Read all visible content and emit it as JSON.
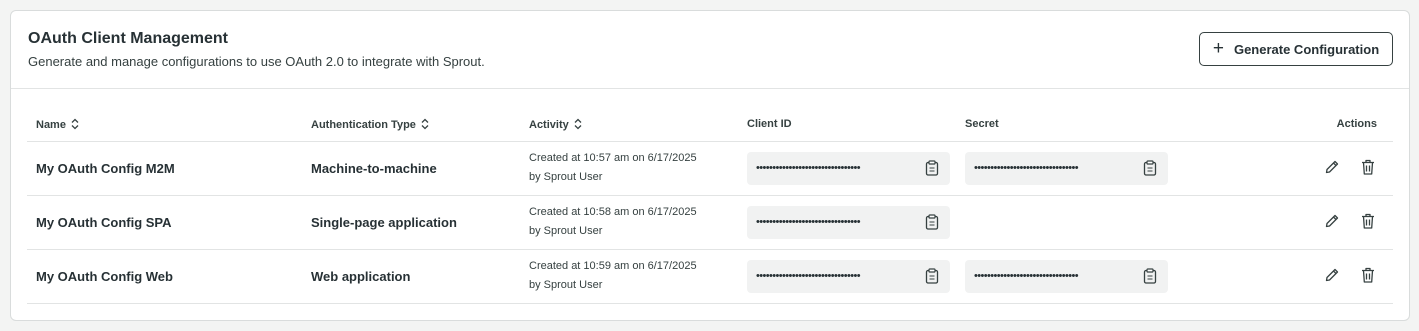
{
  "header": {
    "title": "OAuth Client Management",
    "subtitle": "Generate and manage configurations to use OAuth 2.0 to integrate with Sprout.",
    "generate_label": "Generate Configuration"
  },
  "table": {
    "columns": {
      "name": "Name",
      "auth_type": "Authentication Type",
      "activity": "Activity",
      "client_id": "Client ID",
      "secret": "Secret",
      "actions": "Actions"
    },
    "rows": [
      {
        "name": "My OAuth Config M2M",
        "auth_type": "Machine-to-machine",
        "activity_line1": "Created at 10:57 am on 6/17/2025",
        "activity_line2": "by Sprout User",
        "client_id": "••••••••••••••••••••••••••••••••",
        "secret": "••••••••••••••••••••••••••••••••"
      },
      {
        "name": "My OAuth Config SPA",
        "auth_type": "Single-page application",
        "activity_line1": "Created at 10:58 am on 6/17/2025",
        "activity_line2": "by Sprout User",
        "client_id": "••••••••••••••••••••••••••••••••",
        "secret": ""
      },
      {
        "name": "My OAuth Config Web",
        "auth_type": "Web application",
        "activity_line1": "Created at 10:59 am on 6/17/2025",
        "activity_line2": "by Sprout User",
        "client_id": "••••••••••••••••••••••••••••••••",
        "secret": "••••••••••••••••••••••••••••••••"
      }
    ]
  },
  "icons": {
    "add": "plus-icon",
    "sort": "sort-icon",
    "copy": "clipboard-icon",
    "edit": "pencil-icon",
    "delete": "trash-icon"
  },
  "colors": {
    "text": "#273135",
    "border": "#d9dcdc",
    "field_bg": "#f1f2f2",
    "page_bg": "#f3f4f3"
  }
}
